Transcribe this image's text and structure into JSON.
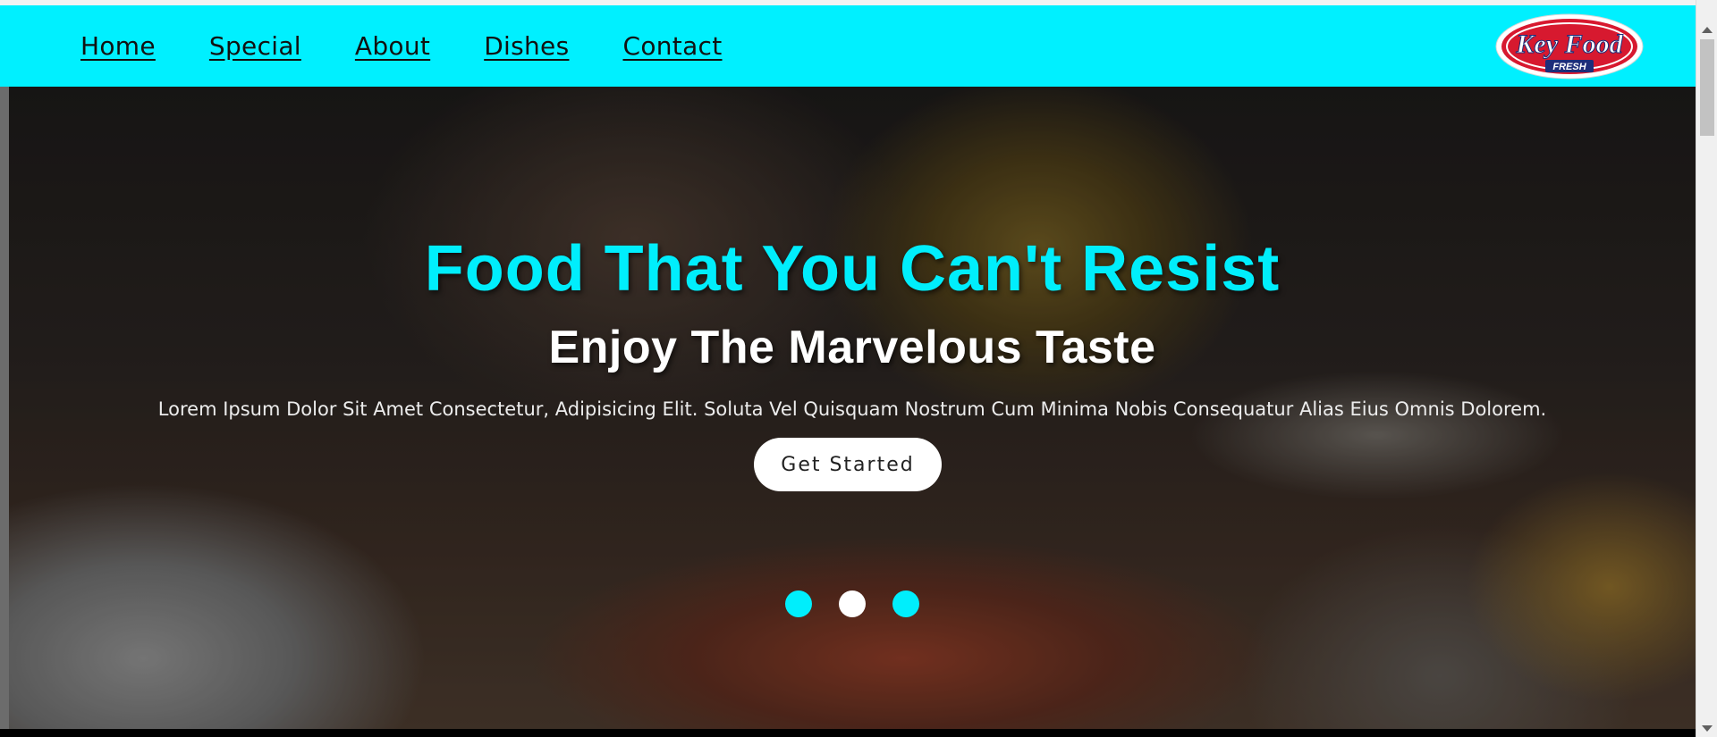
{
  "nav": {
    "items": [
      {
        "label": "Home"
      },
      {
        "label": "Special"
      },
      {
        "label": "About"
      },
      {
        "label": "Dishes"
      },
      {
        "label": "Contact"
      }
    ]
  },
  "logo": {
    "brand": "Key Food",
    "tagline": "FRESH"
  },
  "hero": {
    "title": "Food That You Can't Resist",
    "subtitle": "Enjoy The Marvelous Taste",
    "text": "Lorem Ipsum Dolor Sit Amet Consectetur, Adipisicing Elit. Soluta Vel Quisquam Nostrum Cum Minima Nobis Consequatur Alias Eius Omnis Dolorem.",
    "cta_label": "Get Started"
  },
  "slider": {
    "slide_count": 3,
    "active_index": 1
  },
  "colors": {
    "accent": "#00f0ff",
    "button_bg": "#ffffff",
    "dot_active": "#ffffff",
    "dot_inactive": "#00eefc"
  }
}
